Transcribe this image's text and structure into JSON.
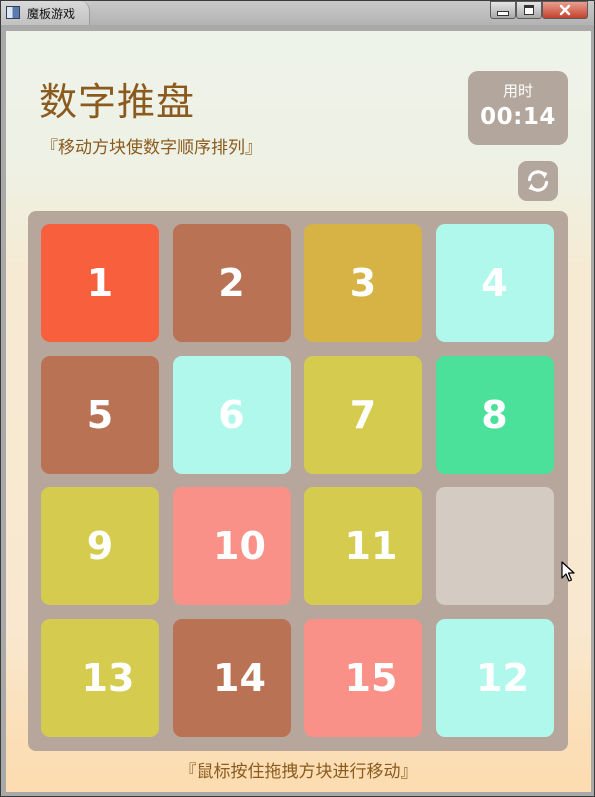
{
  "window": {
    "title": "魔板游戏"
  },
  "header": {
    "title": "数字推盘",
    "subtitle": "『移动方块使数字顺序排列』"
  },
  "timer": {
    "label": "用时",
    "value": "00:14"
  },
  "refresh_button": {
    "icon": "refresh-icon"
  },
  "board": {
    "rows": 4,
    "cols": 4,
    "tiles": [
      {
        "label": "1",
        "color": "#f8603d"
      },
      {
        "label": "2",
        "color": "#b97354"
      },
      {
        "label": "3",
        "color": "#d7b345"
      },
      {
        "label": "4",
        "color": "#b0f8ec"
      },
      {
        "label": "5",
        "color": "#b97354"
      },
      {
        "label": "6",
        "color": "#b0f8ec"
      },
      {
        "label": "7",
        "color": "#d5cc4f"
      },
      {
        "label": "8",
        "color": "#4be19b"
      },
      {
        "label": "9",
        "color": "#d5cc4f"
      },
      {
        "label": "10",
        "color": "#fa9189"
      },
      {
        "label": "11",
        "color": "#d5cc4f"
      },
      {
        "label": "",
        "color": "#d4cbc2",
        "empty": true
      },
      {
        "label": "13",
        "color": "#d5cc4f"
      },
      {
        "label": "14",
        "color": "#b97354"
      },
      {
        "label": "15",
        "color": "#fa9189"
      },
      {
        "label": "12",
        "color": "#b0f8ec"
      }
    ]
  },
  "footer": {
    "hint": "『鼠标按住拖拽方块进行移动』"
  },
  "colors": {
    "title_text": "#8a5a1e",
    "panel": "#b3a69c",
    "board": "#b6a69b"
  }
}
